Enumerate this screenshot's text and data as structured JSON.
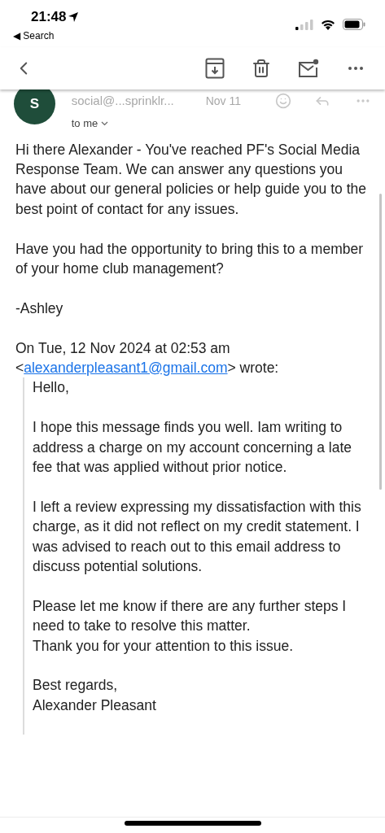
{
  "status_bar": {
    "time": "21:48",
    "back_label": "◀ Search"
  },
  "sender": {
    "initial": "S",
    "address": "social@...sprinklr...",
    "date": "Nov 11",
    "recipient": "to me"
  },
  "message": {
    "paragraphs": [
      "Hi there Alexander - You've reached PF's Social Media Response Team. We can answer any questions you have about our general policies or help guide you to the best point of contact for any issues.",
      "Have you had the opportunity to bring this to a member of your home club management?",
      "-Ashley"
    ],
    "attribution": {
      "text": "On Tue, 12 Nov 2024 at 02:53 am",
      "prefix": "<",
      "email": "alexanderpleasant1@gmail.com",
      "suffix": "> wrote:"
    },
    "quoted": [
      "Hello,",
      "I hope this message finds you well. Iam writing to address a charge on my account concerning a late fee that was applied without prior notice.",
      "I left a review expressing my dissatisfaction with this charge, as it did not reflect on my credit statement. I was advised to reach out to this email address to discuss potential solutions.",
      "Please let me know if there are any further steps I need to take to resolve this matter.\nThank you for your attention to this issue.",
      "Best regards,\nAlexander Pleasant"
    ]
  }
}
